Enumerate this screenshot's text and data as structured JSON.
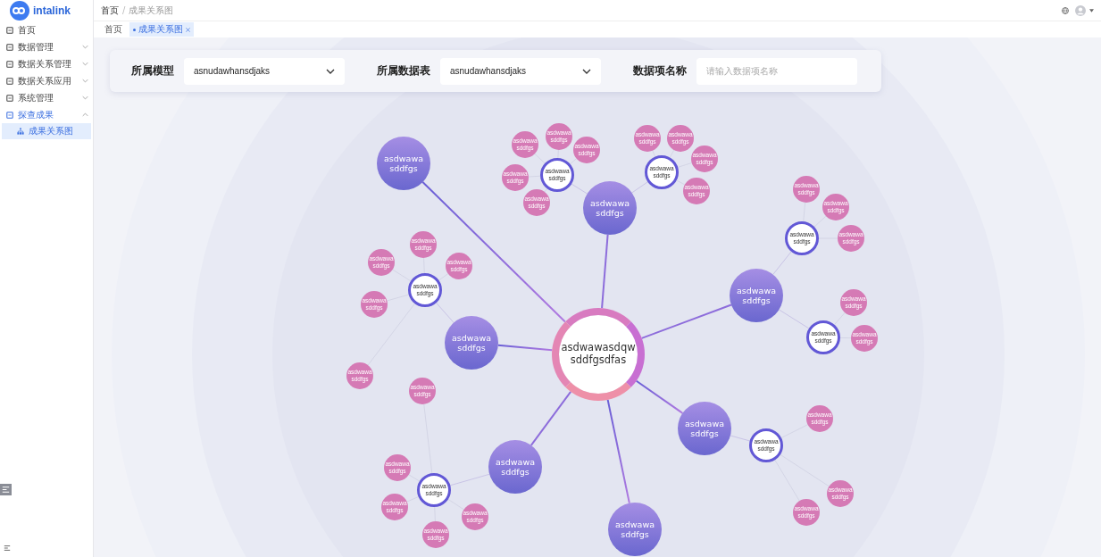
{
  "sidebar": {
    "logo": "intalink",
    "items": [
      {
        "label": "首页",
        "selected": false
      },
      {
        "label": "数据管理",
        "expanded": false,
        "selected": false
      },
      {
        "label": "数据关系管理",
        "expanded": false,
        "selected": false
      },
      {
        "label": "数据关系应用",
        "expanded": false,
        "selected": false
      },
      {
        "label": "系统管理",
        "expanded": false,
        "selected": false
      },
      {
        "label": "探查成果",
        "expanded": true,
        "selected": false,
        "children": [
          {
            "label": "成果关系图",
            "selected": true
          }
        ]
      }
    ]
  },
  "breadcrumb": [
    "首页",
    "成果关系图"
  ],
  "breadcrumb_separator": "/",
  "tabs": [
    {
      "label": "首页",
      "selected": false
    },
    {
      "label": "成果关系图",
      "selected": true
    }
  ],
  "filters": [
    {
      "kind": "select",
      "label": "所属模型",
      "value": "asnudawhansdjaks"
    },
    {
      "kind": "select",
      "label": "所属数据表",
      "value": "asnudawhansdjaks"
    },
    {
      "kind": "input",
      "label": "数据项名称",
      "placeholder": "请输入数据项名称"
    }
  ],
  "graph": {
    "center": {
      "label": "asdwawasdqw sddfgsdfas"
    },
    "nodes": [
      {
        "label": "asdwawa sddfgs"
      },
      {
        "label": "asdwawa sddfgs",
        "children": [
          {
            "label": "asdwawa sddfgs",
            "children": [
              {
                "label": "asdwawa sddfgs"
              },
              {
                "label": "asdwawa sddfgs"
              },
              {
                "label": "asdwawa sddfgs"
              },
              {
                "label": "asdwawa sddfgs"
              },
              {
                "label": "asdwawa sddfgs"
              }
            ]
          },
          {
            "label": "asdwawa sddfgs",
            "children": [
              {
                "label": "asdwawa sddfgs"
              },
              {
                "label": "asdwawa sddfgs"
              },
              {
                "label": "asdwawa sddfgs"
              },
              {
                "label": "asdwawa sddfgs"
              }
            ]
          }
        ]
      },
      {
        "label": "asdwawa sddfgs",
        "children": [
          {
            "label": "asdwawa sddfgs",
            "children": [
              {
                "label": "asdwawa sddfgs"
              },
              {
                "label": "asdwawa sddfgs"
              },
              {
                "label": "asdwawa sddfgs"
              }
            ]
          },
          {
            "label": "asdwawa sddfgs",
            "children": [
              {
                "label": "asdwawa sddfgs"
              },
              {
                "label": "asdwawa sddfgs"
              }
            ]
          }
        ]
      },
      {
        "label": "asdwawa sddfgs",
        "children": [
          {
            "label": "asdwawa sddfgs",
            "children": [
              {
                "label": "asdwawa sddfgs"
              },
              {
                "label": "asdwawa sddfgs"
              },
              {
                "label": "asdwawa sddfgs"
              },
              {
                "label": "asdwawa sddfgs"
              },
              {
                "label": "asdwawa sddfgs"
              }
            ]
          }
        ]
      },
      {
        "label": "asdwawa sddfgs",
        "children": [
          {
            "label": "asdwawa sddfgs",
            "children": [
              {
                "label": "asdwawa sddfgs"
              },
              {
                "label": "asdwawa sddfgs"
              },
              {
                "label": "asdwawa sddfgs"
              },
              {
                "label": "asdwawa sddfgs"
              },
              {
                "label": "asdwawa sddfgs"
              }
            ]
          }
        ]
      },
      {
        "label": "asdwawa sddfgs",
        "children": [
          {
            "label": "asdwawa sddfgs",
            "children": [
              {
                "label": "asdwawa sddfgs"
              },
              {
                "label": "asdwawa sddfgs"
              },
              {
                "label": "asdwawa sddfgs"
              }
            ]
          }
        ]
      },
      {
        "label": "asdwawa sddfgs"
      }
    ]
  }
}
